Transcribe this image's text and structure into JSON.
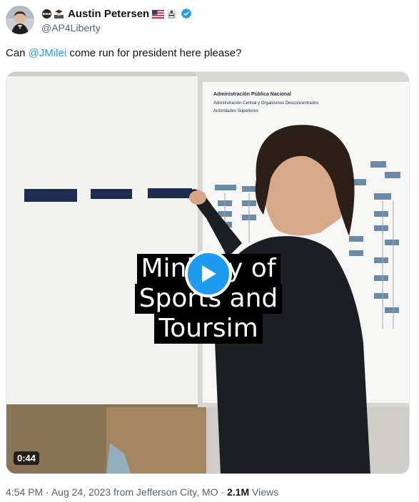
{
  "author": {
    "display_name": "Austin Petersen",
    "handle": "@AP4Liberty",
    "emojis": [
      "ninja-emoji",
      "graduation-emoji"
    ],
    "flags": [
      "us-flag-icon",
      "karate-icon"
    ],
    "verified_color": "#1d9bf0"
  },
  "tweet": {
    "text_prefix": "Can ",
    "mention": "@JMilei",
    "text_suffix": " come run for president here please?"
  },
  "media": {
    "duration": "0:44",
    "caption_lines": [
      "Ministry of",
      "Sports and",
      "Toursim"
    ],
    "org_chart_title": "Administración Pública Nacional",
    "org_chart_subtitle_1": "Administración Central y Organismos Desconcentrados",
    "org_chart_subtitle_2": "Autoridades Superiores"
  },
  "meta": {
    "time": "4:54 PM",
    "date": "Aug 24, 2023",
    "from_text": "from",
    "location": "Jefferson City, MO",
    "separator": "·",
    "views_count": "2.1M",
    "views_label": "Views"
  },
  "colors": {
    "accent": "#1d9bf0",
    "text_primary": "#0f1419",
    "text_secondary": "#536471"
  }
}
